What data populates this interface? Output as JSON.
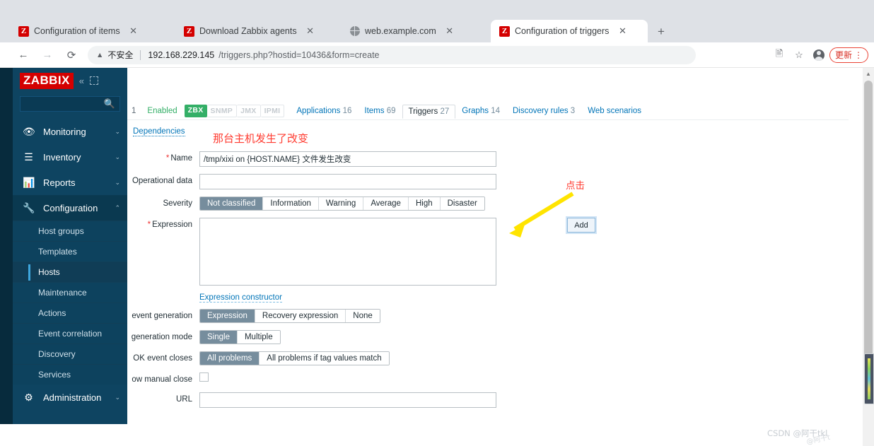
{
  "browser": {
    "tabs": [
      {
        "title": "Configuration of items",
        "favicon": "zabbix-icon",
        "active": false
      },
      {
        "title": "Download Zabbix agents",
        "favicon": "zabbix-icon",
        "active": false
      },
      {
        "title": "web.example.com",
        "favicon": "globe-icon",
        "active": false
      },
      {
        "title": "Configuration of triggers",
        "favicon": "zabbix-icon",
        "active": true
      }
    ],
    "new_tab_label": "+",
    "close_glyph": "✕",
    "window_controls": {
      "minimize_all": "⌄",
      "minimize": "–",
      "maximize": "❐",
      "close": "✕"
    },
    "nav": {
      "back": "←",
      "forward": "→",
      "reload": "⟳"
    },
    "address": {
      "security_icon": "warning-triangle-icon",
      "security_text": "不安全",
      "url_host": "192.168.229.145",
      "url_path": "/triggers.php?hostid=10436&form=create"
    },
    "toolbar_right": {
      "translate_icon": "translate-icon",
      "bookmark_icon": "star-icon",
      "profile_icon": "avatar-icon",
      "update_label": "更新",
      "menu_icon": "kebab-menu-icon"
    }
  },
  "sidebar": {
    "logo": "ZABBIX",
    "collapse_icon": "«",
    "compact_icon": "compact-view-icon",
    "search_placeholder": "",
    "search_icon": "search-icon",
    "items": [
      {
        "label": "Monitoring",
        "icon": "eye-icon",
        "caret": "⌄"
      },
      {
        "label": "Inventory",
        "icon": "list-icon",
        "caret": "⌄"
      },
      {
        "label": "Reports",
        "icon": "bar-chart-icon",
        "caret": "⌄"
      },
      {
        "label": "Configuration",
        "icon": "wrench-icon",
        "caret": "⌃"
      }
    ],
    "configuration_submenu": [
      "Host groups",
      "Templates",
      "Hosts",
      "Maintenance",
      "Actions",
      "Event correlation",
      "Discovery",
      "Services"
    ],
    "current_submenu": "Hosts",
    "administration": {
      "label": "Administration",
      "icon": "gear-icon",
      "caret": "⌄"
    }
  },
  "host_tabs": {
    "cut_prefix": "1",
    "status": "Enabled",
    "interface_chips": [
      {
        "label": "ZBX",
        "active": true
      },
      {
        "label": "SNMP",
        "active": false
      },
      {
        "label": "JMX",
        "active": false
      },
      {
        "label": "IPMI",
        "active": false
      }
    ],
    "links": [
      {
        "label": "Applications",
        "count": "16",
        "selected": false
      },
      {
        "label": "Items",
        "count": "69",
        "selected": false
      },
      {
        "label": "Triggers",
        "count": "27",
        "selected": true
      },
      {
        "label": "Graphs",
        "count": "14",
        "selected": false
      },
      {
        "label": "Discovery rules",
        "count": "3",
        "selected": false
      },
      {
        "label": "Web scenarios",
        "count": "",
        "selected": false
      }
    ]
  },
  "form": {
    "dependencies_tab": "Dependencies",
    "name": {
      "label": "Name",
      "required": true,
      "value": "/tmp/xixi on {HOST.NAME} 文件发生改变"
    },
    "operational_data": {
      "label": "Operational data",
      "required": false,
      "value": ""
    },
    "severity": {
      "label": "Severity",
      "options": [
        "Not classified",
        "Information",
        "Warning",
        "Average",
        "High",
        "Disaster"
      ],
      "selected": "Not classified"
    },
    "expression": {
      "label": "Expression",
      "required": true,
      "value": "",
      "add_button": "Add",
      "constructor_link": "Expression constructor"
    },
    "ok_event_generation": {
      "label": "event generation",
      "options": [
        "Expression",
        "Recovery expression",
        "None"
      ],
      "selected": "Expression"
    },
    "problem_event_generation_mode": {
      "label": "generation mode",
      "options": [
        "Single",
        "Multiple"
      ],
      "selected": "Single"
    },
    "ok_event_closes": {
      "label": "OK event closes",
      "options": [
        "All problems",
        "All problems if tag values match"
      ],
      "selected": "All problems"
    },
    "allow_manual_close": {
      "label": "ow manual close",
      "checked": false
    },
    "url": {
      "label": "URL",
      "value": ""
    }
  },
  "annotations": {
    "title_note": "那台主机发生了改变",
    "click_note": "点击",
    "accent_red": "#ff3b30",
    "arrow_yellow": "#ffe400"
  },
  "watermark": {
    "text": "CSDN @阿干tkl",
    "text2": "@阿干t"
  }
}
